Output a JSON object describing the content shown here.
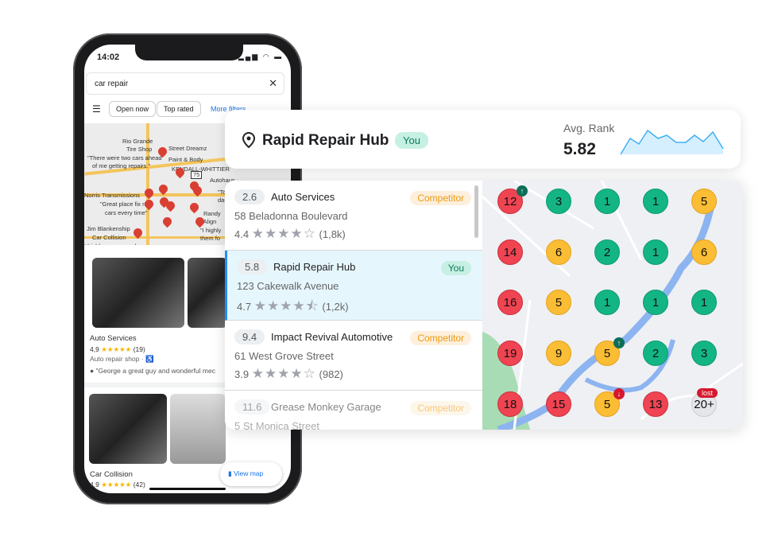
{
  "phone": {
    "time": "14:02",
    "status_icons": "signal wifi battery",
    "search_value": "car repair",
    "chips": [
      "Open now",
      "Top rated"
    ],
    "more_filters": "More filters",
    "map_labels": [
      "Rio Grande",
      "Tire Shop",
      "\"There were two cars ahead",
      "of me getting repairs.\"",
      "Street Dreamz",
      "Paint & Body",
      "KENDALL-WHITTIER",
      "Autohaus",
      "\"Toby rep",
      "daughte",
      "Norris Transmissions",
      "\"Great place fix my",
      "cars every time\"",
      "Randy",
      "& Align",
      "\"I highly",
      "them fo",
      "Jim Blankenship",
      "Car Collision",
      "I highly recommend",
      "75"
    ],
    "results": [
      {
        "name": "Auto Services",
        "rating": "4,9",
        "stars": "★★★★★",
        "count": "(19)",
        "type": "Auto repair shop ·",
        "review": "\"George a great guy and wonderful mec"
      },
      {
        "name": "Car Collision",
        "rating": "4,9",
        "stars": "★★★★★",
        "count": "(42)"
      }
    ],
    "view_map": "View map"
  },
  "header": {
    "business": "Rapid Repair Hub",
    "you_badge": "You",
    "avg_label": "Avg. Rank",
    "avg_value": "5.82"
  },
  "list": [
    {
      "rank": "2.6",
      "name": "Auto Services",
      "badge": "Competitor",
      "address": "58 Beladonna Boulevard",
      "rating": "4.4",
      "stars": "★★★★☆",
      "reviews": "(1,8k)"
    },
    {
      "rank": "5.8",
      "name": "Rapid Repair Hub",
      "badge": "You",
      "address": "123 Cakewalk Avenue",
      "rating": "4.7",
      "stars": "★★★★⯪",
      "reviews": "(1,2k)",
      "selected": true
    },
    {
      "rank": "9.4",
      "name": "Impact Revival Automotive",
      "badge": "Competitor",
      "address": "61 West Grove Street",
      "rating": "3.9",
      "stars": "★★★★☆",
      "reviews": "(982)"
    },
    {
      "rank": "11.6",
      "name": "Grease Monkey Garage",
      "badge": "Competitor",
      "address": "5 St Monica Street"
    }
  ],
  "grid": {
    "colors": {
      "red": "#f04452",
      "green": "#13b585",
      "yellow": "#fbbd33",
      "none": "#e4e6ea"
    },
    "rows": [
      [
        "12",
        "3",
        "1",
        "1",
        "5"
      ],
      [
        "14",
        "6",
        "2",
        "1",
        "6"
      ],
      [
        "16",
        "5",
        "1",
        "1",
        "1"
      ],
      [
        "19",
        "9",
        "5",
        "2",
        "3"
      ],
      [
        "18",
        "15",
        "5",
        "13",
        "20+"
      ]
    ],
    "trend": [
      [
        "up",
        0,
        0
      ],
      [
        "up",
        3,
        2
      ],
      [
        "down",
        4,
        2
      ]
    ],
    "lost_label": "lost"
  }
}
